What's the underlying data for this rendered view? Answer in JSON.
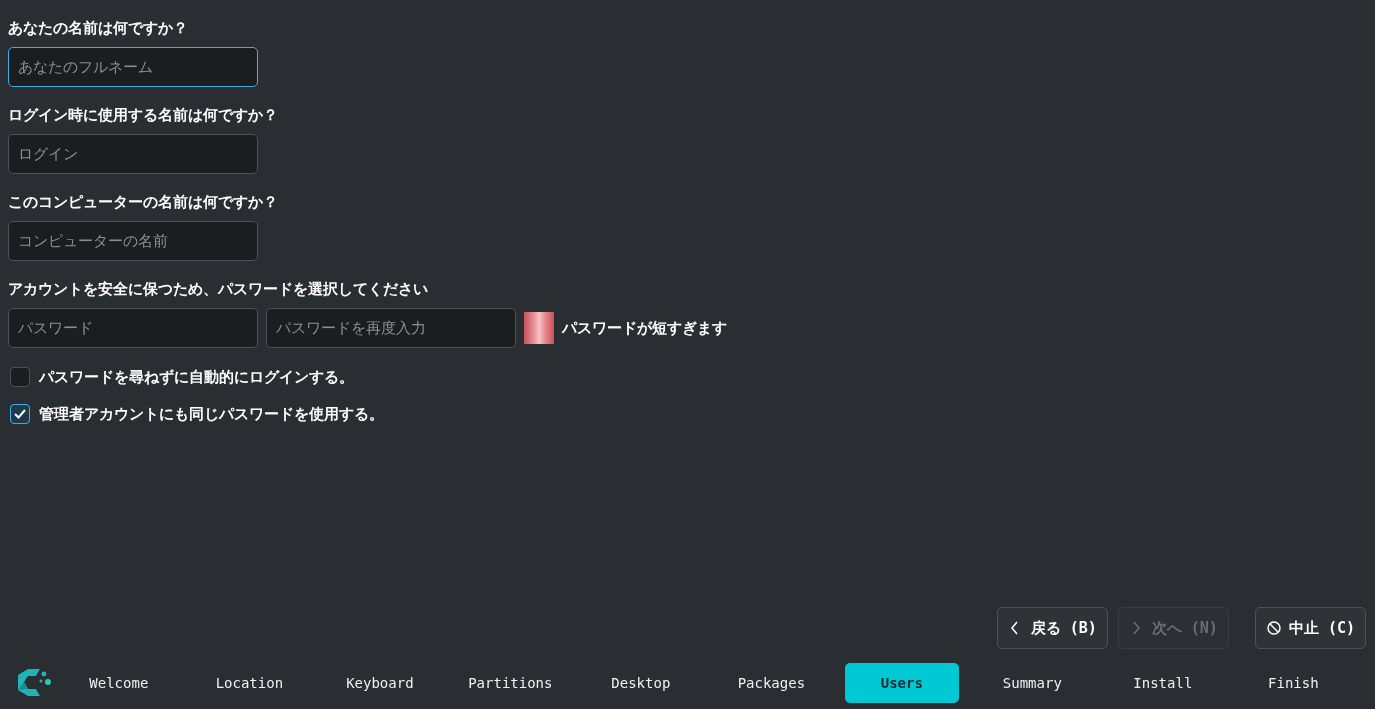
{
  "questions": [
    {
      "label": "あなたの名前は何ですか？",
      "placeholder": "あなたのフルネーム",
      "focused": true
    },
    {
      "label": "ログイン時に使用する名前は何ですか？",
      "placeholder": "ログイン",
      "focused": false
    },
    {
      "label": "このコンピューターの名前は何ですか？",
      "placeholder": "コンピューターの名前",
      "focused": false
    }
  ],
  "password": {
    "label": "アカウントを安全に保つため、パスワードを選択してください",
    "fields": [
      {
        "placeholder": "パスワード",
        "focused": false
      },
      {
        "placeholder": "パスワードを再度入力",
        "focused": false
      }
    ],
    "message": "パスワードが短すぎます"
  },
  "checkboxes": [
    {
      "label": "パスワードを尋ねずに自動的にログインする。",
      "checked": false
    },
    {
      "label": "管理者アカウントにも同じパスワードを使用する。",
      "checked": true
    }
  ],
  "buttons": [
    {
      "kind": "back",
      "label": "戻る (B)",
      "disabled": false
    },
    {
      "kind": "next",
      "label": "次へ (N)",
      "disabled": true
    },
    {
      "kind": "cancel",
      "label": "中止 (C)",
      "disabled": false
    }
  ],
  "steps": [
    {
      "label": "Welcome",
      "selected": false
    },
    {
      "label": "Location",
      "selected": false
    },
    {
      "label": "Keyboard",
      "selected": false
    },
    {
      "label": "Partitions",
      "selected": false
    },
    {
      "label": "Desktop",
      "selected": false
    },
    {
      "label": "Packages",
      "selected": false
    },
    {
      "label": "Users",
      "selected": true
    },
    {
      "label": "Summary",
      "selected": false
    },
    {
      "label": "Install",
      "selected": false
    },
    {
      "label": "Finish",
      "selected": false
    }
  ]
}
